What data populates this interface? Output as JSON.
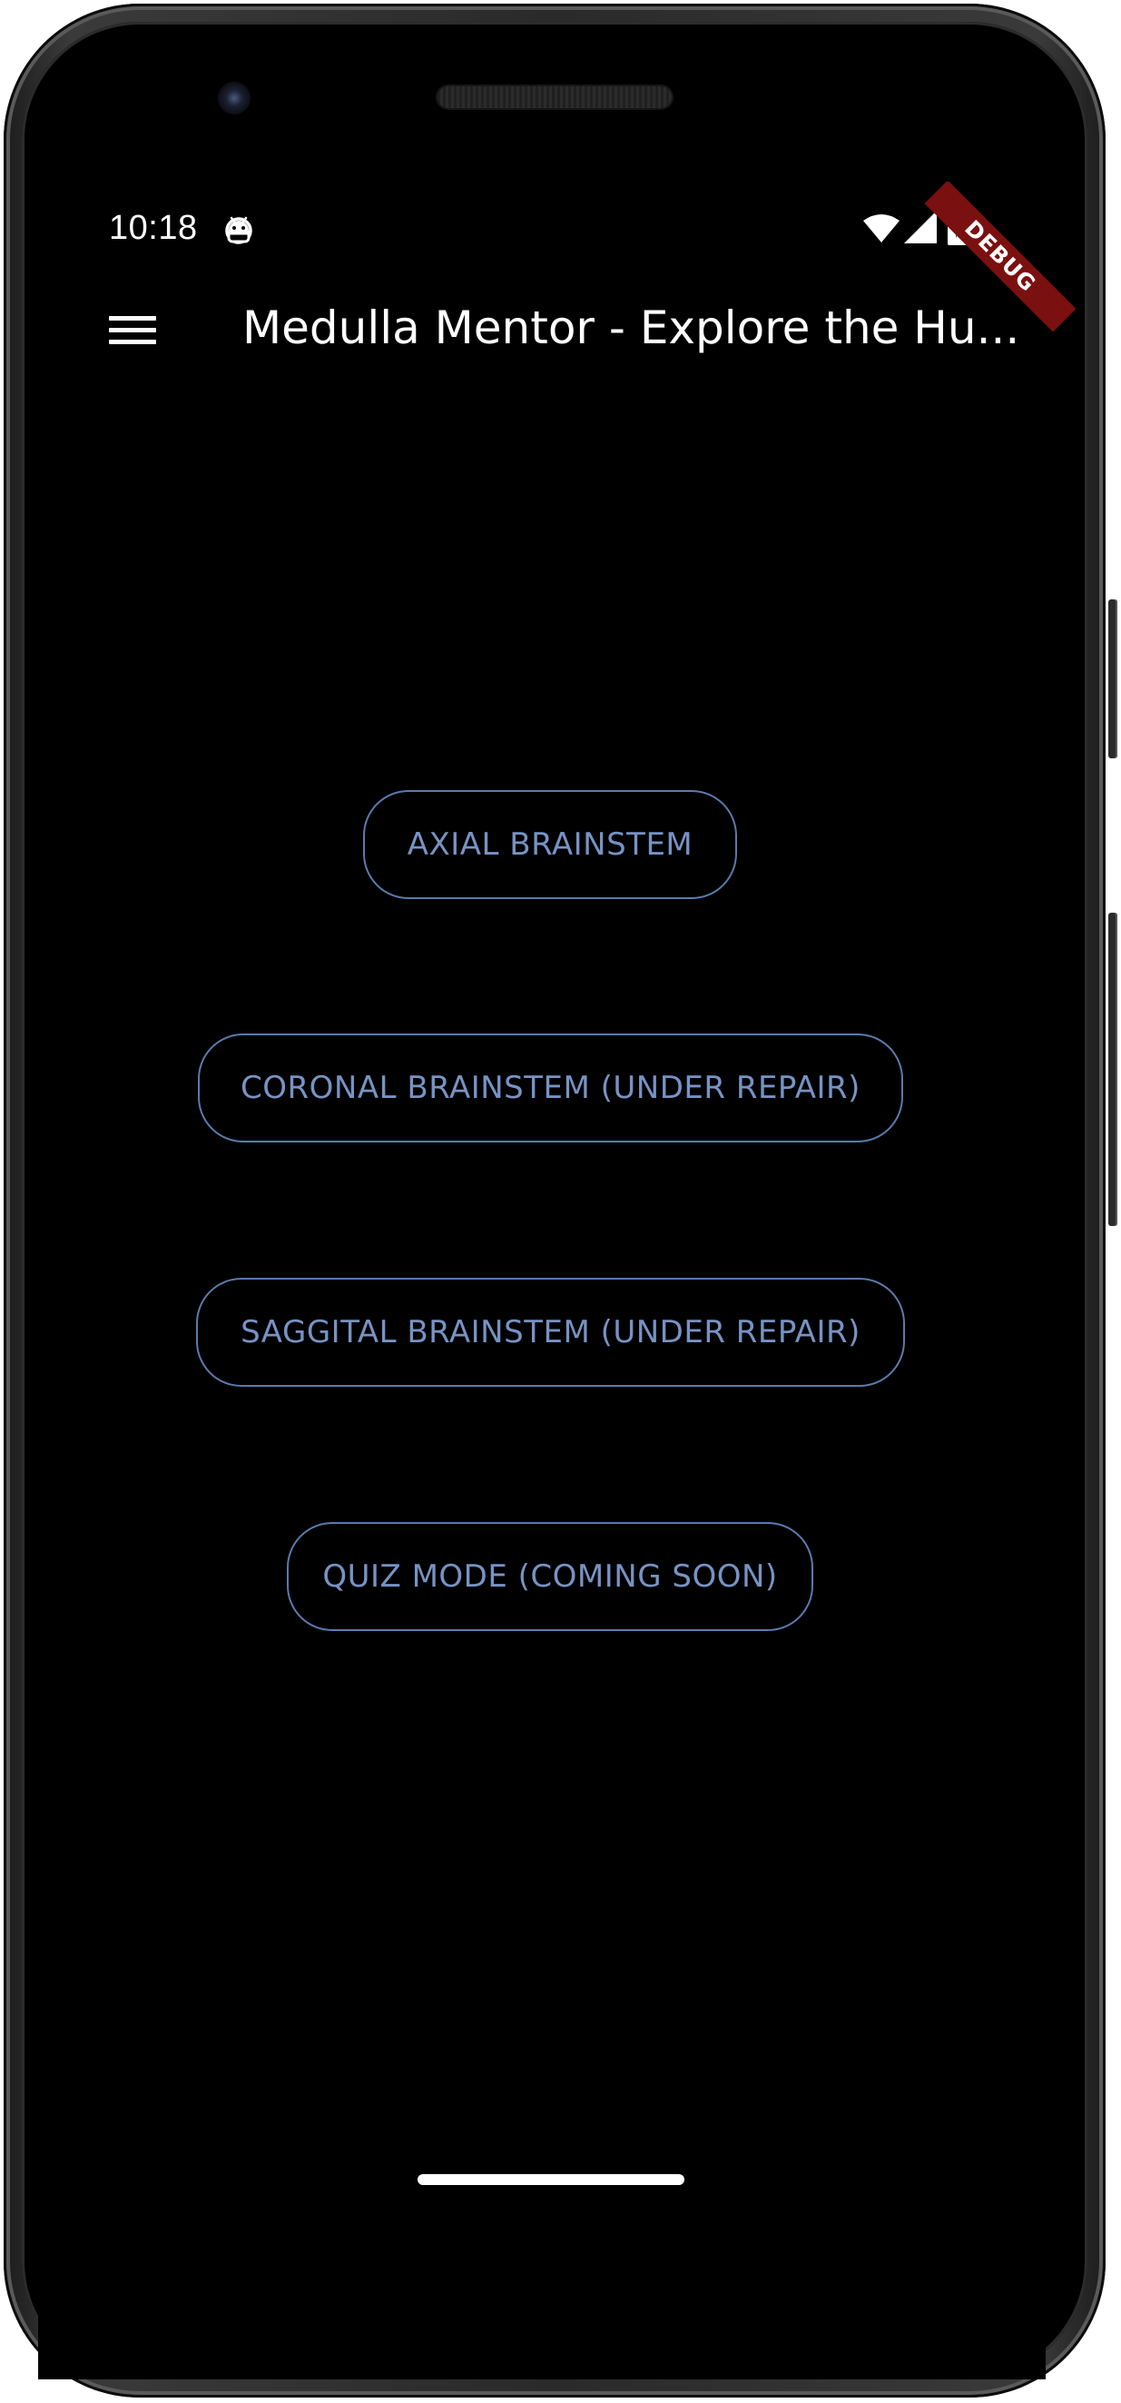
{
  "status_bar": {
    "time": "10:18",
    "app_icon": "android-robot-icon",
    "wifi_icon": "wifi-icon",
    "signal_icon": "cell-signal-icon",
    "battery_icon": "battery-charging-icon"
  },
  "debug_banner": {
    "label": "DEBUG",
    "color": "#7b1010"
  },
  "app_bar": {
    "menu_icon": "hamburger-menu-icon",
    "title": "Medulla Mentor - Explore the Hu..."
  },
  "menu_buttons": [
    {
      "label": "AXIAL BRAINSTEM"
    },
    {
      "label": "CORONAL BRAINSTEM (UNDER REPAIR)"
    },
    {
      "label": "SAGGITAL BRAINSTEM (UNDER REPAIR)"
    },
    {
      "label": "QUIZ MODE (COMING SOON)"
    }
  ],
  "theme": {
    "background": "#000000",
    "button_border": "#5a7bae",
    "button_text": "#7793c4",
    "text": "#ffffff"
  }
}
